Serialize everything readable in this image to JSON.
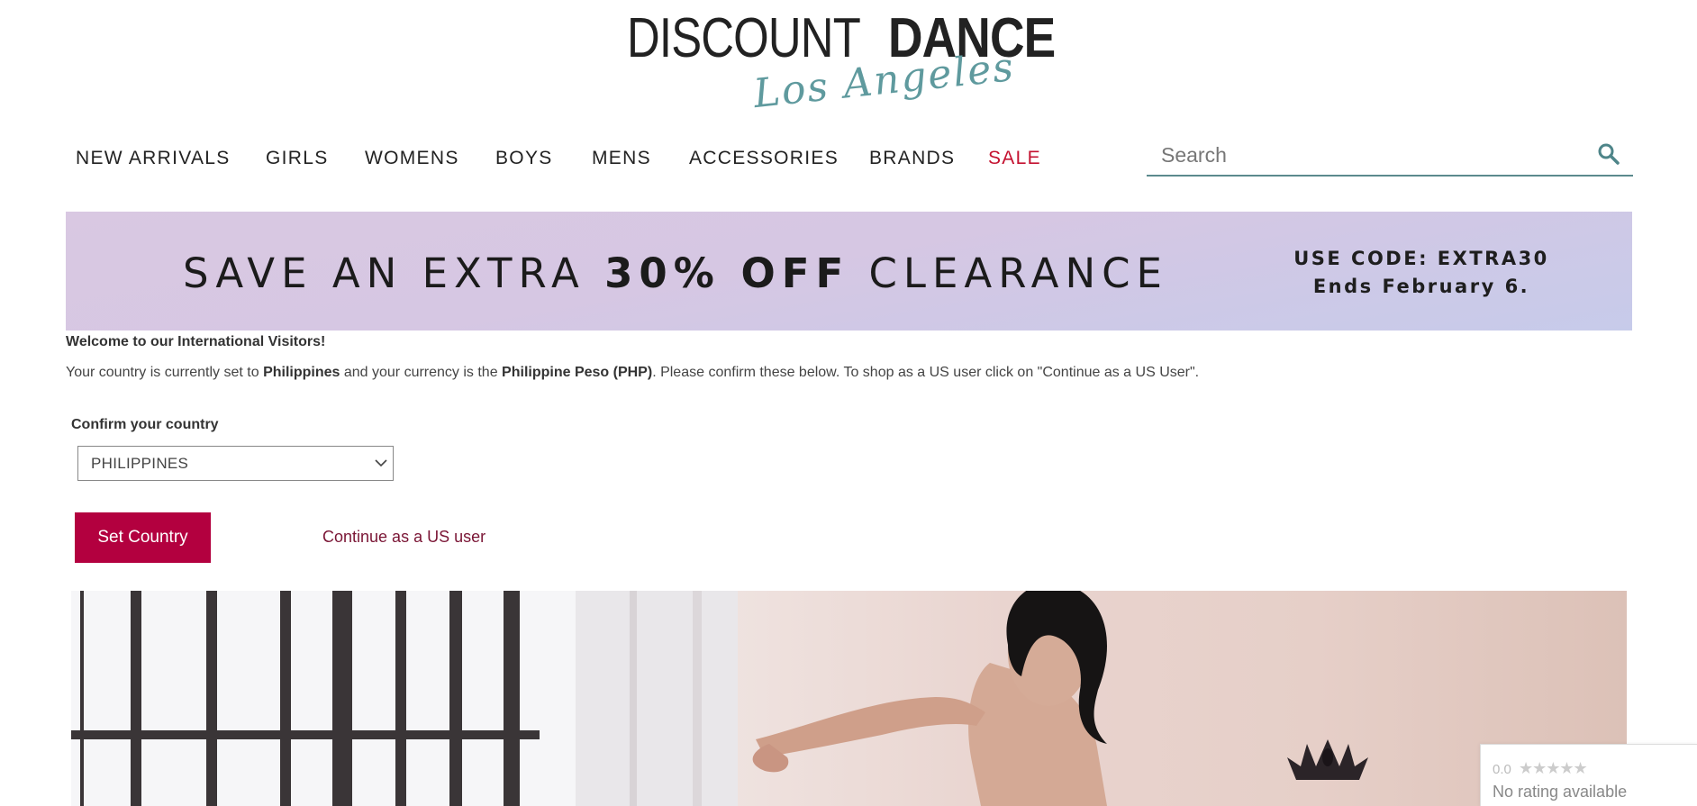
{
  "logo": {
    "top_light": "DISCOUNT",
    "top_bold": "DANCE",
    "script": "Los Angeles"
  },
  "nav": {
    "items": [
      {
        "label": "NEW ARRIVALS"
      },
      {
        "label": "GIRLS"
      },
      {
        "label": "WOMENS"
      },
      {
        "label": "BOYS"
      },
      {
        "label": "MENS"
      },
      {
        "label": "ACCESSORIES"
      },
      {
        "label": "BRANDS"
      },
      {
        "label": "SALE"
      }
    ]
  },
  "search": {
    "placeholder": "Search",
    "icon": "search-icon"
  },
  "banner": {
    "prefix": "SAVE AN EXTRA ",
    "highlight": "30% OFF",
    "suffix": " CLEARANCE",
    "code_line": "USE CODE: EXTRA30",
    "ends_line": "Ends February 6."
  },
  "international": {
    "welcome": "Welcome to our International Visitors!",
    "msg_part1": "Your country is currently set to ",
    "country_name": "Philippines",
    "msg_part2": " and your currency is the ",
    "currency_name": "Philippine Peso (PHP)",
    "msg_part3": ". Please confirm these below. To shop as a US user click on \"Continue as a US User\".",
    "confirm_label": "Confirm your country",
    "selected_country": "PHILIPPINES",
    "set_button": "Set Country",
    "continue_link": "Continue as a US user"
  },
  "rating": {
    "score": "0.0",
    "stars": "★★★★★",
    "text": "No rating available"
  },
  "colors": {
    "accent": "#b3003f",
    "sale": "#c41230",
    "teal": "#5b8a8d"
  }
}
